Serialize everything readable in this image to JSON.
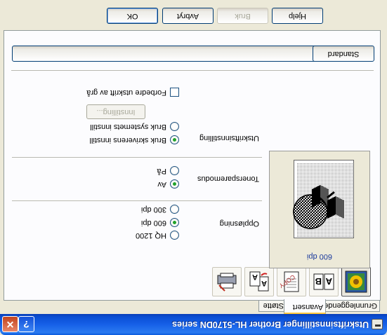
{
  "window": {
    "title": "Utskriftsinnstillinger Brother HL-5170DN series"
  },
  "tabs": [
    {
      "label": "Grunnleggende",
      "active": false
    },
    {
      "label": "Avansert",
      "active": true
    },
    {
      "label": "Støtte",
      "active": false
    }
  ],
  "toolbar_icons": [
    "print-quality-icon",
    "duplex-icon",
    "watermark-icon",
    "page-setting-icon",
    "device-options-icon"
  ],
  "preview": {
    "resolution_label": "600 dpi"
  },
  "resolution": {
    "label": "Oppløsning",
    "options": [
      {
        "label": "HQ 1200",
        "selected": false
      },
      {
        "label": "600 dpi",
        "selected": true
      },
      {
        "label": "300 dpi",
        "selected": false
      }
    ]
  },
  "toner_save": {
    "label": "Tonersparemodus",
    "options": [
      {
        "label": "Av",
        "selected": true
      },
      {
        "label": "På",
        "selected": false
      }
    ]
  },
  "print_setting": {
    "label": "Utskriftsinnstilling",
    "options": [
      {
        "label": "Bruk skriverens innstill",
        "selected": true
      },
      {
        "label": "Bruk systemets innstill",
        "selected": false
      }
    ],
    "settings_button": "Innstilling...",
    "improve_gray_label": "Forbedre utskrift av grå",
    "improve_gray_checked": false
  },
  "default_button": "Standard",
  "buttons": {
    "ok": "OK",
    "cancel": "Avbryt",
    "apply": "Bruk",
    "help": "Hjelp"
  },
  "colors": {
    "titlebar": "#0b4fd4",
    "tab_highlight": "#ffc83c",
    "radio_dot": "#22a22a",
    "dpi_text": "#1b3a9c"
  }
}
